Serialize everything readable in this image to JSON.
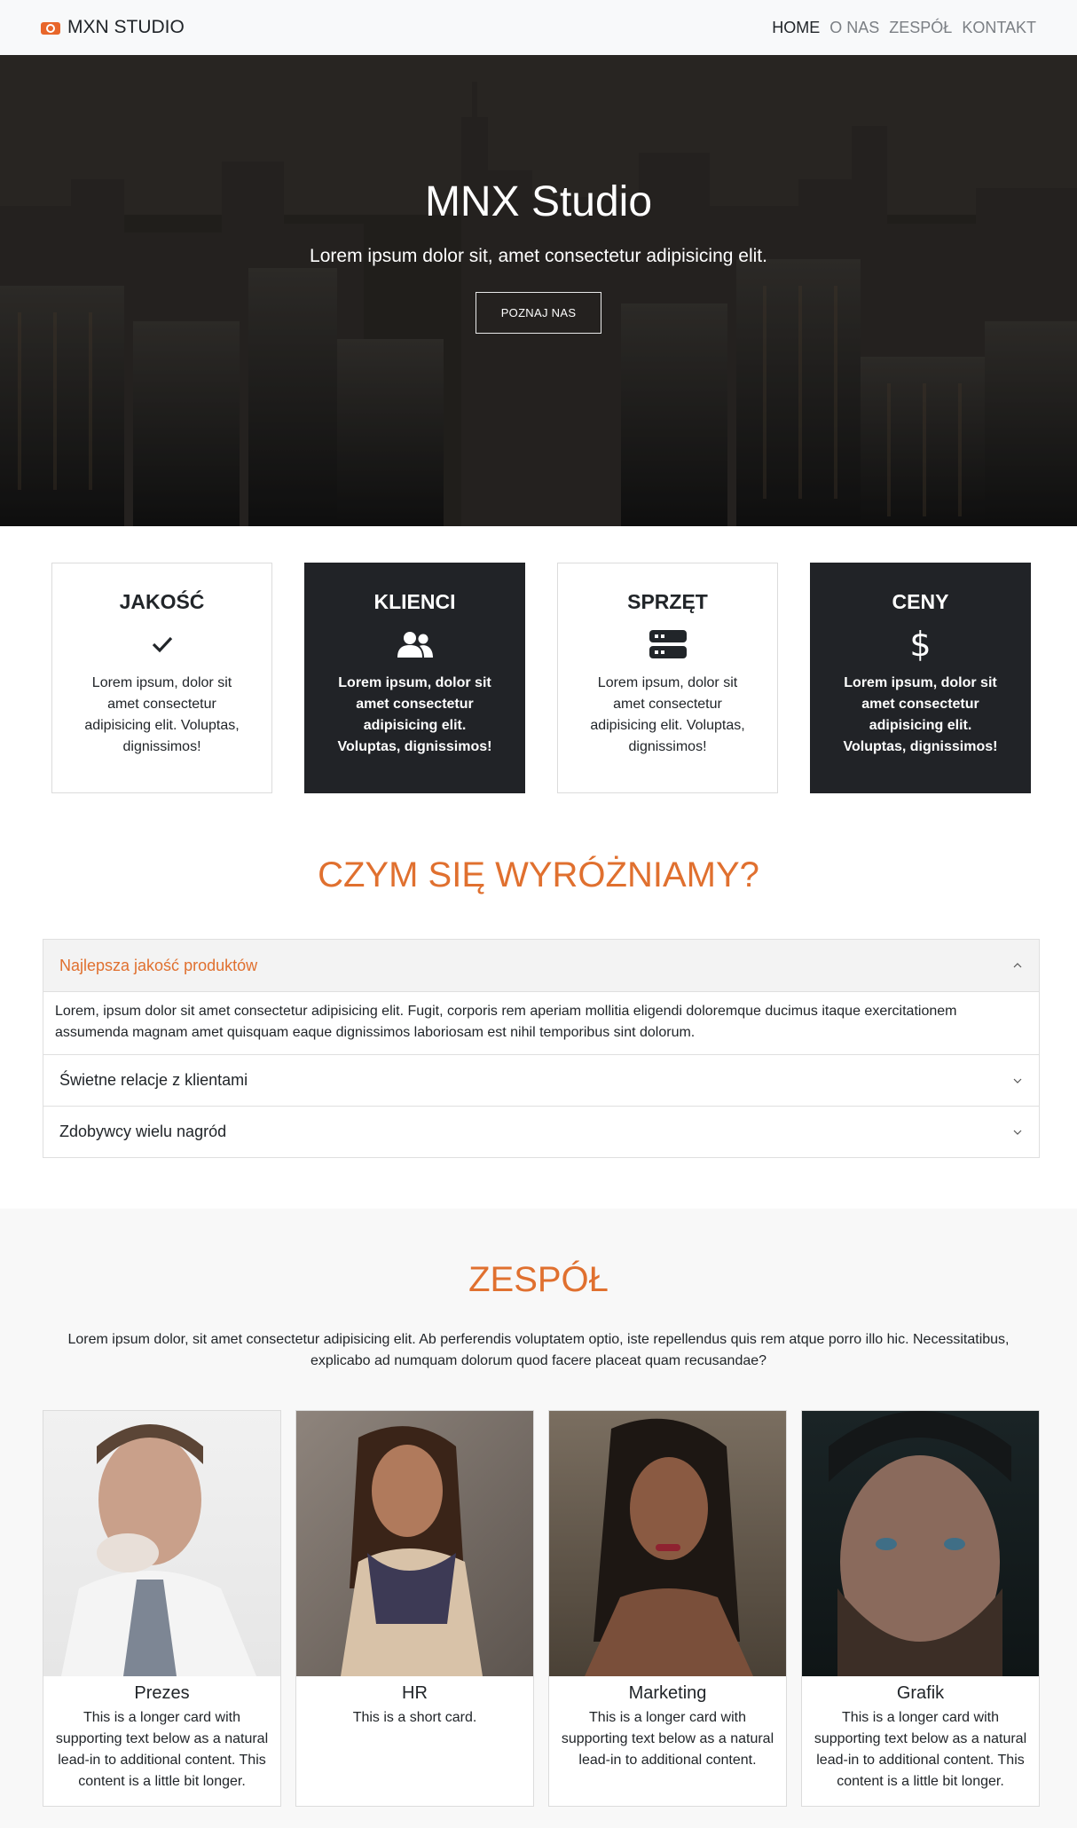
{
  "navbar": {
    "brand": "MXN STUDIO",
    "links": [
      {
        "label": "HOME"
      },
      {
        "label": "O NAS"
      },
      {
        "label": "ZESPÓŁ"
      },
      {
        "label": "KONTAKT"
      }
    ]
  },
  "hero": {
    "title": "MNX Studio",
    "subtitle": "Lorem ipsum dolor sit, amet consectetur adipisicing elit.",
    "button": "POZNAJ NAS"
  },
  "features": [
    {
      "title": "JAKOŚĆ",
      "icon": "check-icon",
      "text": "Lorem ipsum, dolor sit amet consectetur adipisicing elit. Voluptas, dignissimos!"
    },
    {
      "title": "KLIENCI",
      "icon": "users-icon",
      "text": "Lorem ipsum, dolor sit amet consectetur adipisicing elit. Voluptas, dignissimos!"
    },
    {
      "title": "SPRZĘT",
      "icon": "server-icon",
      "text": "Lorem ipsum, dolor sit amet consectetur adipisicing elit. Voluptas, dignissimos!"
    },
    {
      "title": "CENY",
      "icon": "dollar-icon",
      "text": "Lorem ipsum, dolor sit amet consectetur adipisicing elit. Voluptas, dignissimos!"
    }
  ],
  "about": {
    "heading": "CZYM SIĘ WYRÓŻNIAMY?",
    "accordion": [
      {
        "title": "Najlepsza jakość produktów",
        "expanded": true,
        "body": "Lorem, ipsum dolor sit amet consectetur adipisicing elit. Fugit, corporis rem aperiam mollitia eligendi doloremque ducimus itaque exercitationem assumenda magnam amet quisquam eaque dignissimos laboriosam est nihil temporibus sint dolorum."
      },
      {
        "title": "Świetne relacje z klientami",
        "expanded": false
      },
      {
        "title": "Zdobywcy wielu nagród",
        "expanded": false
      }
    ]
  },
  "team": {
    "heading": "ZESPÓŁ",
    "intro": "Lorem ipsum dolor, sit amet consectetur adipisicing elit. Ab perferendis voluptatem optio, iste repellendus quis rem atque porro illo hic. Necessitatibus, explicabo ad numquam dolorum quod facere placeat quam recusandae?",
    "members": [
      {
        "name": "Prezes",
        "text": "This is a longer card with supporting text below as a natural lead-in to additional content. This content is a little bit longer."
      },
      {
        "name": "HR",
        "text": "This is a short card."
      },
      {
        "name": "Marketing",
        "text": "This is a longer card with supporting text below as a natural lead-in to additional content."
      },
      {
        "name": "Grafik",
        "text": "This is a longer card with supporting text below as a natural lead-in to additional content. This content is a little bit longer."
      }
    ]
  },
  "colors": {
    "accent": "#e0702f",
    "dark_card": "#212327",
    "navbar_bg": "#f8f9fa"
  }
}
